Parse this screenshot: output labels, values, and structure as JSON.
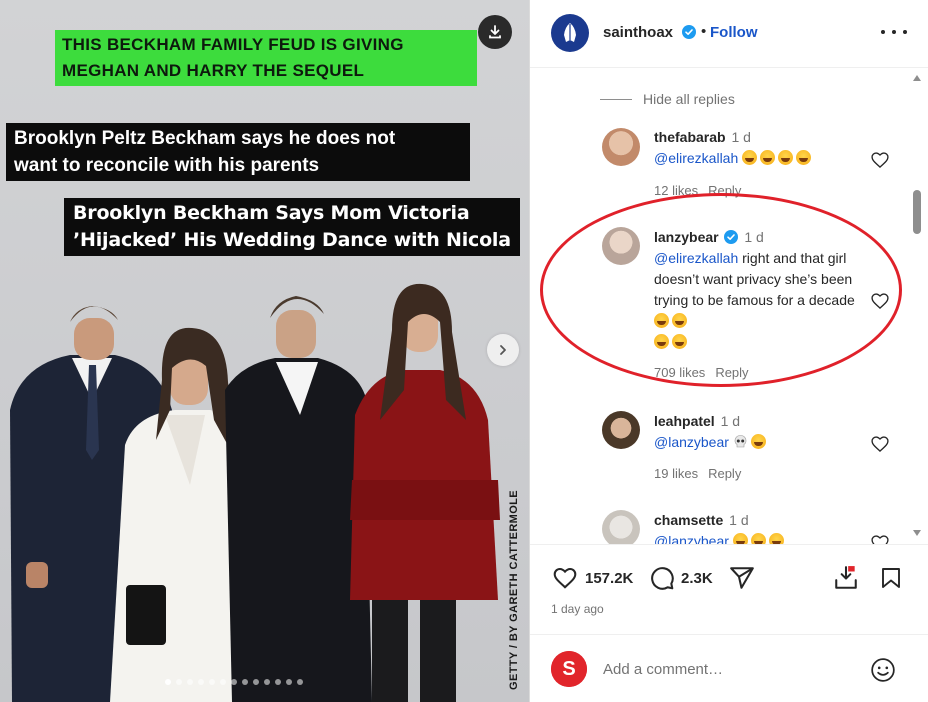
{
  "post": {
    "headline": [
      "THIS BECKHAM FAMILY FEUD IS GIVING",
      "MEGHAN AND HARRY THE SEQUEL"
    ],
    "caption1": [
      "Brooklyn Peltz Beckham says he does not",
      "want to reconcile with his parents"
    ],
    "caption2": [
      "Brooklyn Beckham Says Mom Victoria",
      "’Hijacked’ His Wedding Dance with Nicola"
    ],
    "photo_credit": "GETTY / BY GARETH CATTERMOLE",
    "carousel_dots": 13,
    "carousel_active": 0,
    "colors": {
      "headline_bg": "#3ddc3d",
      "caption_bg": "#0c0c0c",
      "image_bg": "#cfd0d2"
    }
  },
  "header": {
    "username": "sainthoax",
    "verified": true,
    "separator": "•",
    "follow_label": "Follow",
    "more_icon": "more-horizontal-icon"
  },
  "comments": {
    "hide_replies_label": "Hide all replies",
    "items": [
      {
        "user": "thefabarab",
        "time": "1 d",
        "verified": false,
        "mention": "@elirezkallah",
        "text": "",
        "emoji_count": 4,
        "likes": "12 likes",
        "reply": "Reply"
      },
      {
        "user": "lanzybear",
        "time": "1 d",
        "verified": true,
        "mention": "@elirezkallah",
        "text": " right and that girl doesn’t want privacy she’s been trying to be famous for a decade",
        "emoji_count": 4,
        "likes": "709 likes",
        "reply": "Reply",
        "highlighted": true
      },
      {
        "user": "leahpatel",
        "time": "1 d",
        "verified": false,
        "mention": "@lanzybear",
        "text": "",
        "emojis": [
          "skull-emoji",
          "rofl-emoji"
        ],
        "likes": "19 likes",
        "reply": "Reply"
      },
      {
        "user": "chamsette",
        "time": "1 d",
        "verified": false,
        "mention": "@lanzybear",
        "text": "",
        "emoji_count": 3
      }
    ],
    "highlight_color": "#e0212a"
  },
  "actions": {
    "likes_count": "157.2K",
    "comments_count": "2.3K",
    "post_time": "1 day ago",
    "icons": [
      "heart-icon",
      "comment-icon",
      "share-icon",
      "download-save-icon",
      "bookmark-icon"
    ]
  },
  "add_comment": {
    "placeholder": "Add a comment…",
    "avatar_letter": "S"
  },
  "colors": {
    "link_blue": "#1a56c9",
    "muted": "#737373",
    "text": "#262626"
  }
}
